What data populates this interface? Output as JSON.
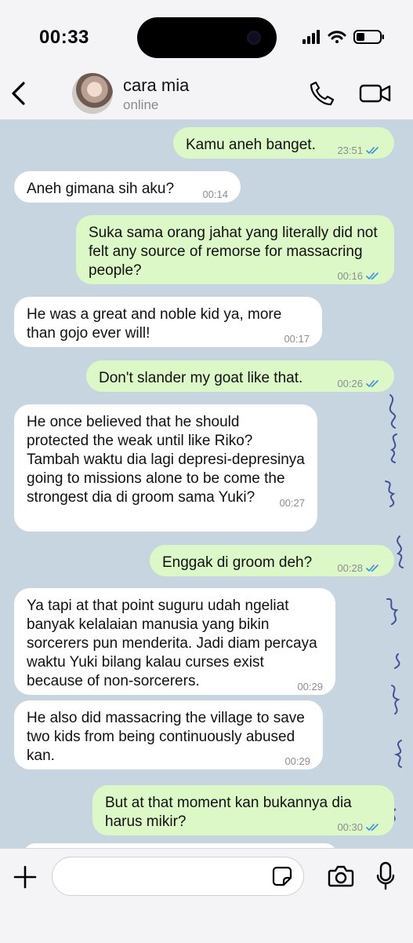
{
  "status_bar": {
    "time": "00:33"
  },
  "header": {
    "contact_name": "cara mia",
    "contact_status": "online"
  },
  "messages": [
    {
      "dir": "out",
      "text": "Kamu aneh banget.",
      "time": "23:51",
      "read": true
    },
    {
      "dir": "in",
      "text": "Aneh gimana sih aku?",
      "time": "00:14"
    },
    {
      "dir": "out",
      "text": "Suka sama orang jahat yang literally did not felt any source of remorse for massacring people?",
      "time": "00:16",
      "read": true
    },
    {
      "dir": "in",
      "text": "He was a great and noble kid ya, more than gojo ever will!",
      "time": "00:17"
    },
    {
      "dir": "out",
      "text": "Don't slander my goat like that.",
      "time": "00:26",
      "read": true
    },
    {
      "dir": "in",
      "text": "He once believed that he should protected the weak until like Riko? Tambah waktu dia lagi depresi-depresinya going to missions alone to be come the strongest dia di groom sama Yuki?",
      "time": "00:27"
    },
    {
      "dir": "out",
      "text": "Enggak di groom deh?",
      "time": "00:28",
      "read": true
    },
    {
      "dir": "in",
      "text": "Ya tapi at that point suguru udah ngeliat banyak kelalaian manusia yang bikin sorcerers pun menderita. Jadi diam percaya waktu Yuki bilang kalau curses exist because of non-sorcerers.",
      "time": "00:29"
    },
    {
      "dir": "in",
      "text": "He also did massacring the village to save two kids from being continuously abused kan.",
      "time": "00:29"
    },
    {
      "dir": "out",
      "text": "But at that moment kan bukannya dia harus mikir?",
      "time": "00:30",
      "read": true
    }
  ],
  "colors": {
    "outgoing_bubble": "#dbf8c6",
    "incoming_bubble": "#ffffff",
    "read_tick": "#3d8fe0",
    "chat_bg": "#c3d3de"
  },
  "icons": [
    "back-chevron-icon",
    "phone-icon",
    "video-camera-icon",
    "plus-icon",
    "sticker-icon",
    "camera-icon",
    "microphone-icon"
  ]
}
